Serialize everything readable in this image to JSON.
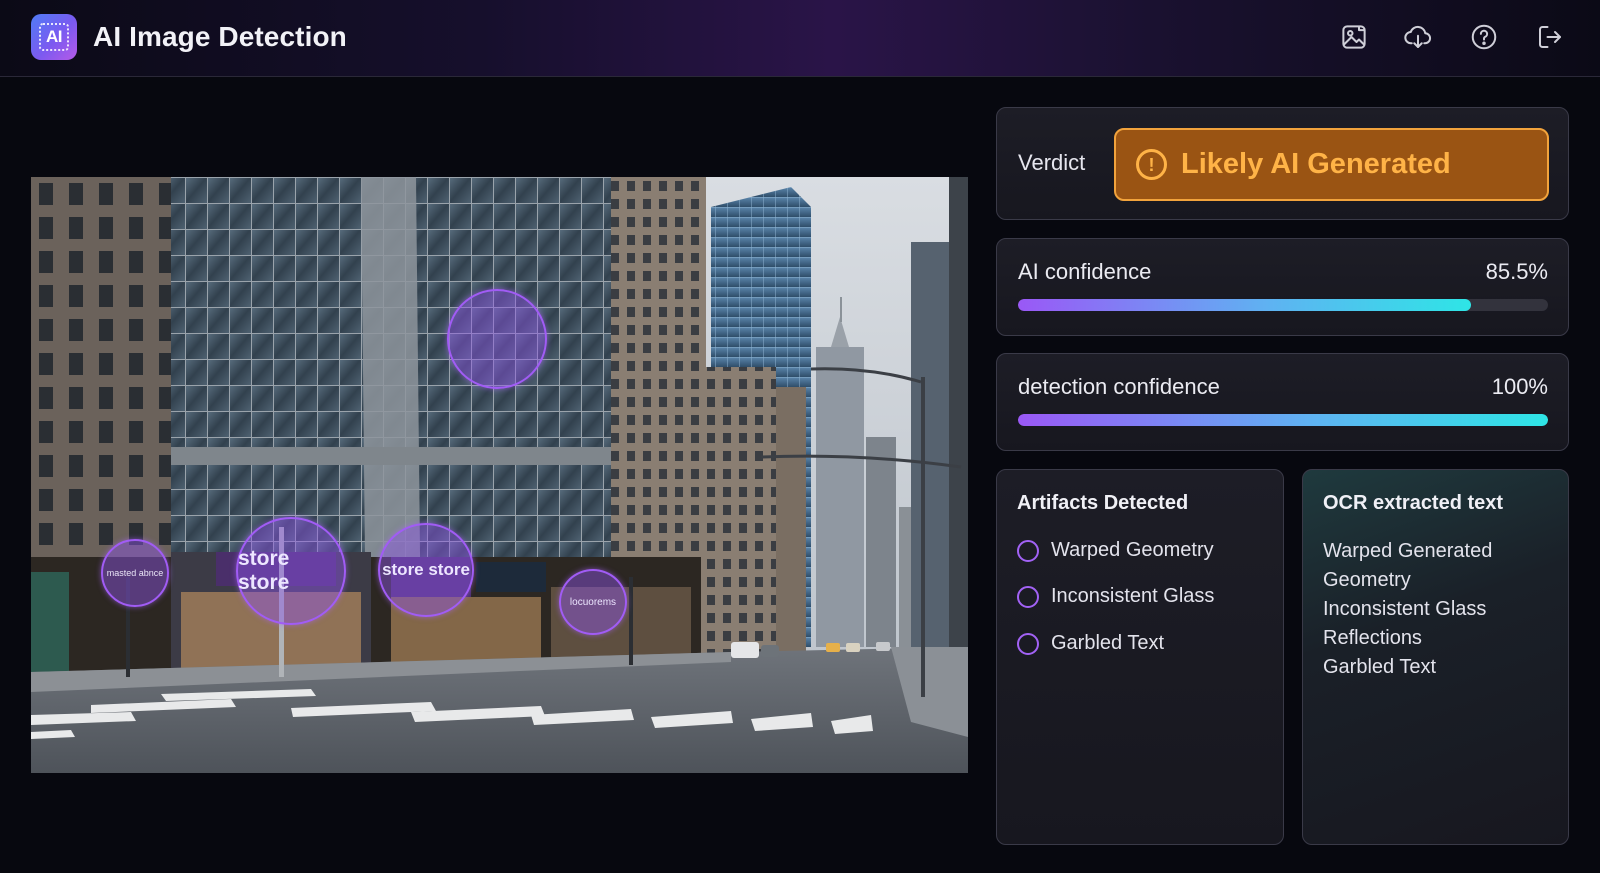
{
  "app": {
    "logo_text": "AI",
    "title": "AI Image Detection"
  },
  "toolbar": {
    "icons": [
      "image-icon",
      "cloud-download-icon",
      "help-icon",
      "logout-icon"
    ]
  },
  "image": {
    "markers": [
      {
        "label": "masted abnce"
      },
      {
        "label": "store store"
      },
      {
        "label": "store store"
      },
      {
        "label": "locuorems"
      },
      {
        "label": ""
      }
    ]
  },
  "verdict": {
    "label": "Verdict",
    "value": "Likely AI Generated",
    "color": "#f2a33c"
  },
  "ai_confidence": {
    "label": "AI confidence",
    "value_text": "85.5%",
    "value": 0.855
  },
  "detection_confidence": {
    "label": "detection confidence",
    "value_text": "100%",
    "value": 1.0
  },
  "artifacts": {
    "title": "Artifacts Detected",
    "items": [
      "Warped Geometry",
      "Inconsistent Glass",
      "Garbled Text"
    ]
  },
  "ocr": {
    "title": "OCR extracted text",
    "lines": [
      "Warped Generated",
      "Geometry",
      "Inconsistent Glass",
      "Reflections",
      "Garbled Text"
    ]
  },
  "colors": {
    "accent": "#a15cf5",
    "bar_start": "#9a58f6",
    "bar_end": "#2ee5e6"
  }
}
